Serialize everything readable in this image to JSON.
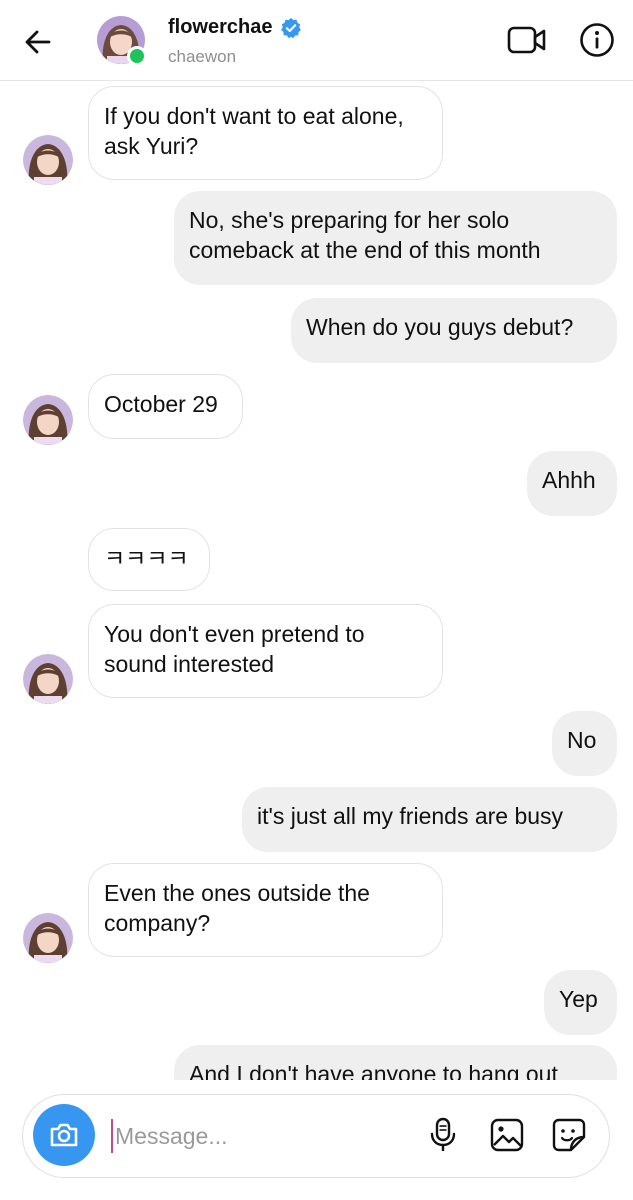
{
  "header": {
    "username": "flowerchae",
    "subname": "chaewon",
    "icons": {
      "back": "arrow-left-icon",
      "verified": "verified-badge-icon",
      "video": "video-camera-icon",
      "info": "info-icon"
    },
    "colors": {
      "verified": "#3897f0",
      "online": "#1dc35b"
    }
  },
  "messages": [
    {
      "side": "in",
      "text": "If you don't want to eat alone, ask Yuri?"
    },
    {
      "side": "out",
      "text": "No, she's preparing for her solo comeback at the end of this month"
    },
    {
      "side": "out",
      "text": "When do you guys debut?"
    },
    {
      "side": "in",
      "text": "October 29"
    },
    {
      "side": "out",
      "text": "Ahhh"
    },
    {
      "side": "in",
      "text": "ㅋㅋㅋㅋ"
    },
    {
      "side": "in",
      "text": "You don't even pretend to sound interested"
    },
    {
      "side": "out",
      "text": "No"
    },
    {
      "side": "out",
      "text": "it's just all my friends are busy"
    },
    {
      "side": "in",
      "text": "Even the ones outside the company?"
    },
    {
      "side": "out",
      "text": "Yep"
    },
    {
      "side": "out",
      "text": "And I don't have anyone to hang out"
    }
  ],
  "composer": {
    "placeholder": "Message...",
    "icons": {
      "camera": "camera-icon",
      "mic": "microphone-icon",
      "gallery": "image-icon",
      "sticker": "sticker-icon"
    },
    "colors": {
      "camera_button": "#3797f0",
      "caret": "#c04a84"
    }
  },
  "colors": {
    "incoming_bubble_border": "#e3e3e3",
    "outgoing_bubble": "#efefef",
    "subtext": "#8e8e8e"
  }
}
